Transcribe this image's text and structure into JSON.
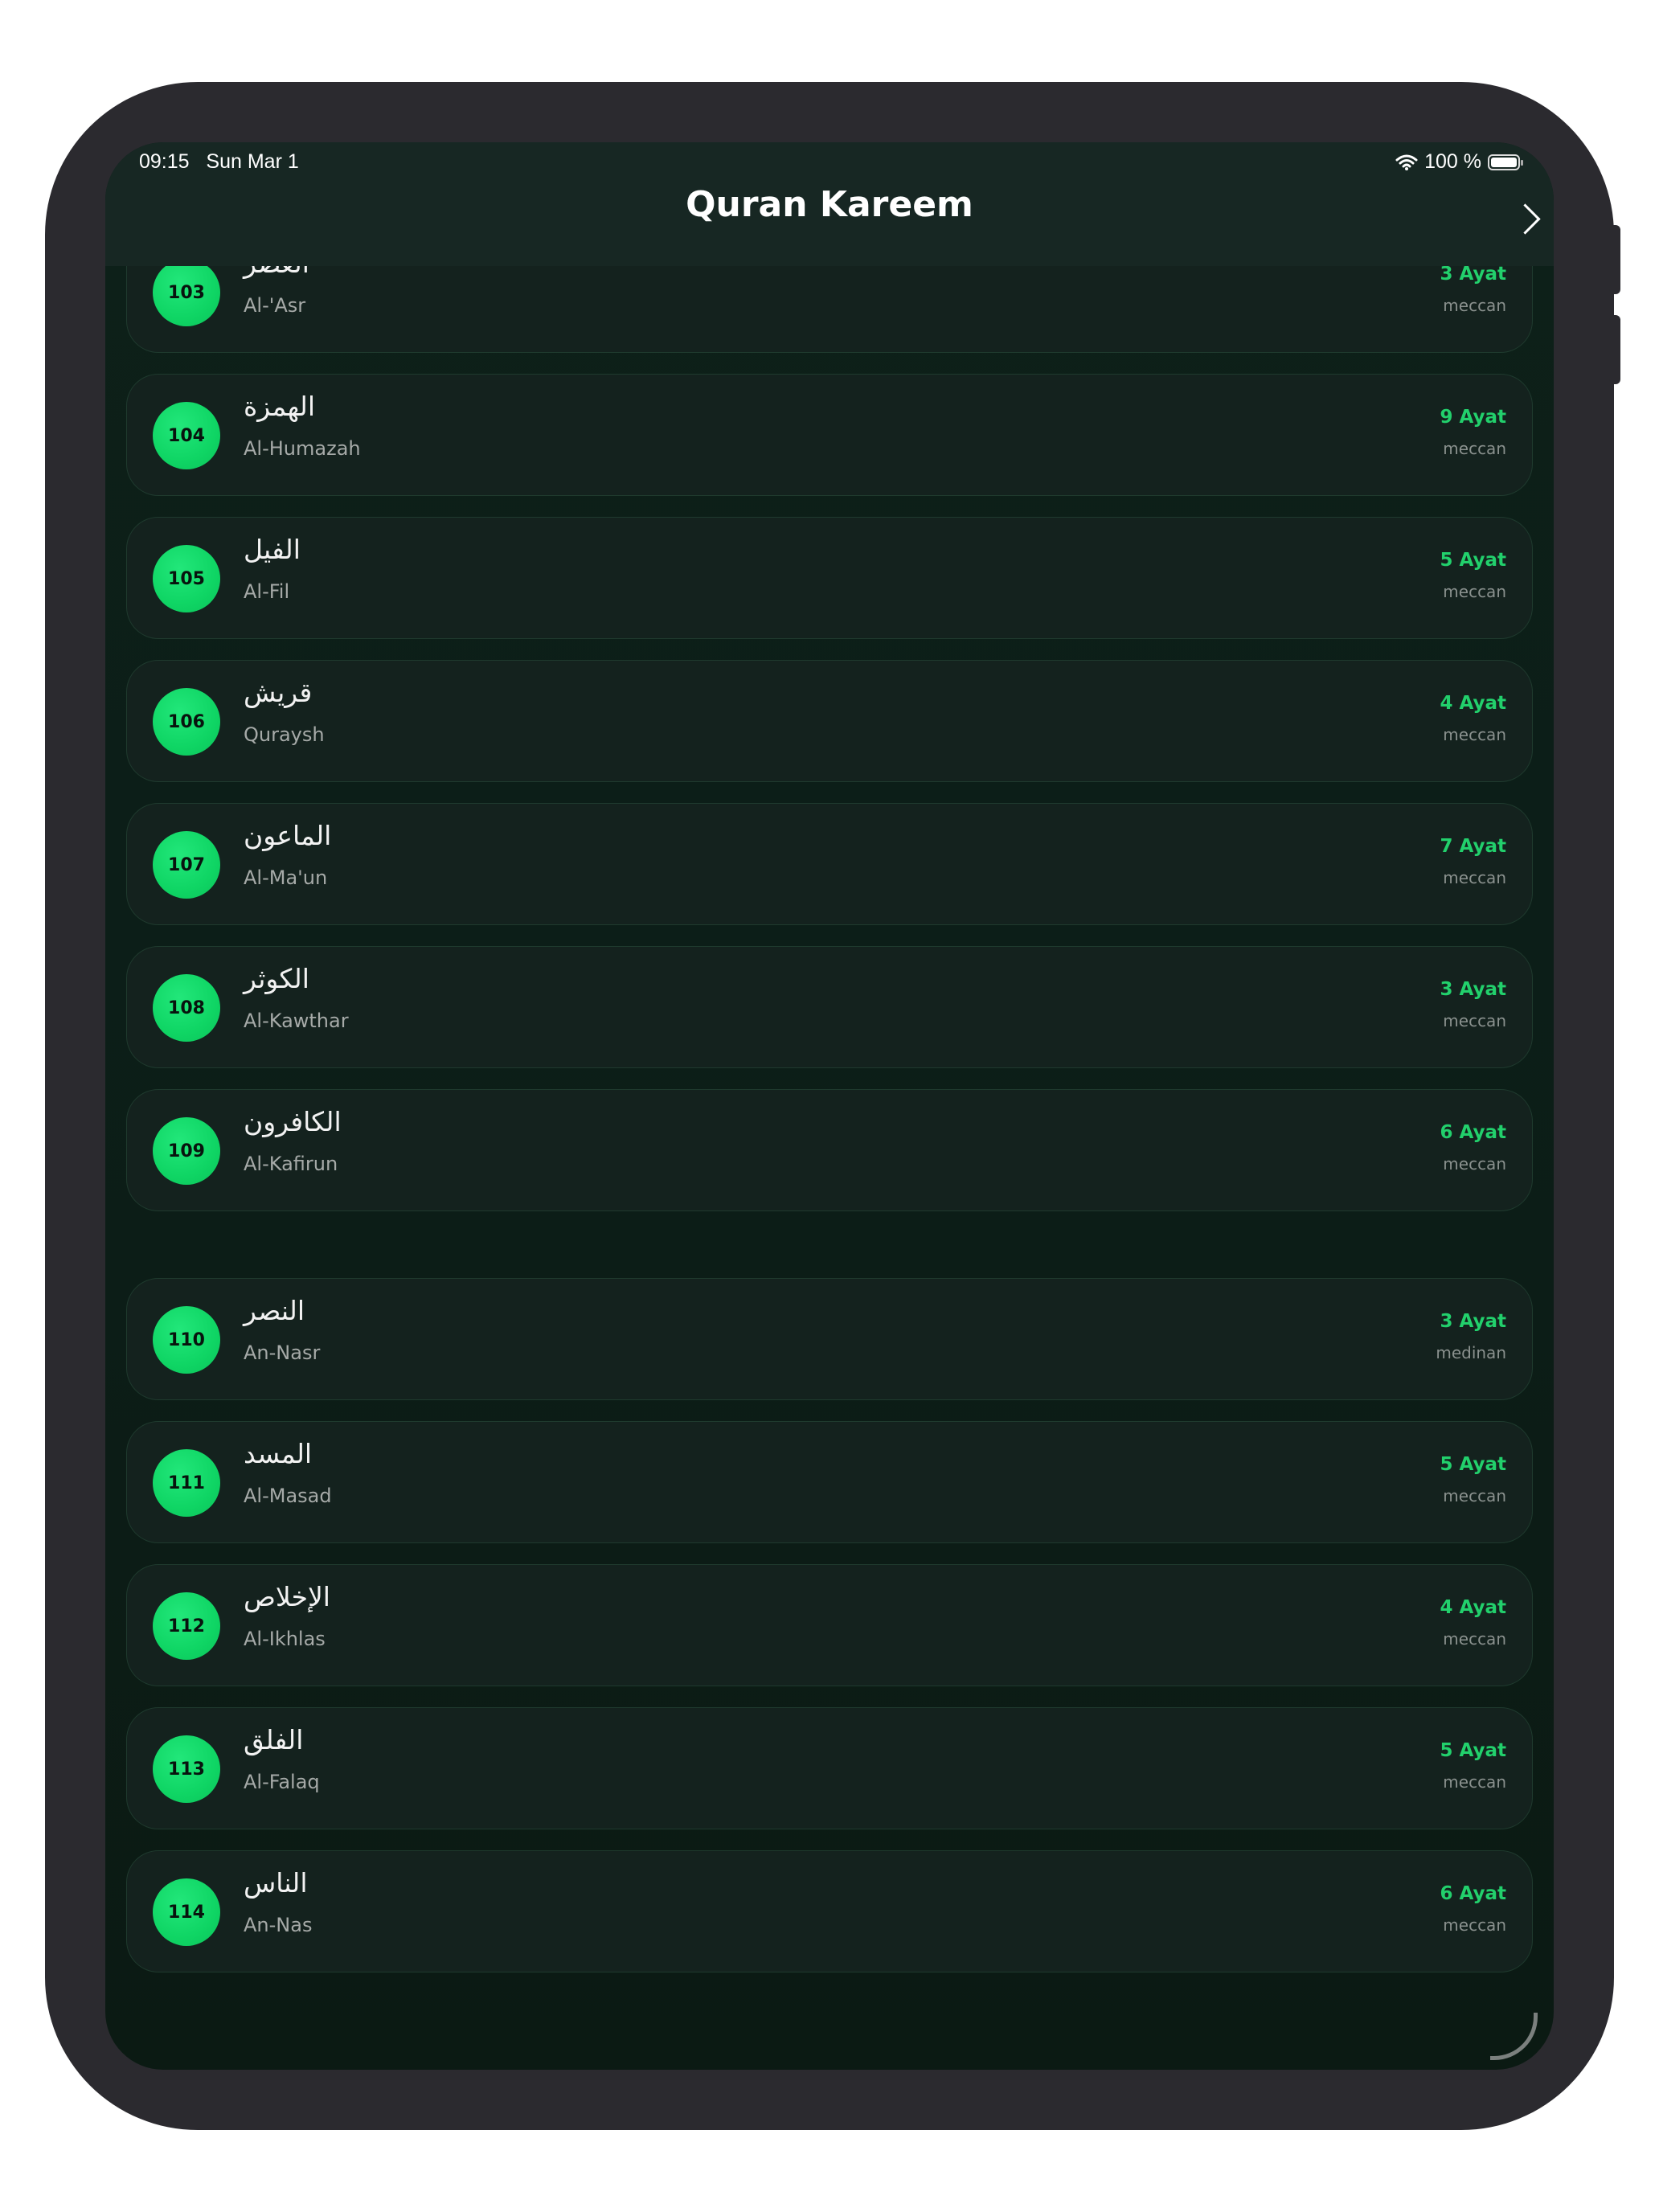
{
  "status_bar": {
    "time": "09:15",
    "date": "Sun Mar 1",
    "battery": "100 %"
  },
  "header": {
    "title": "Quran Kareem"
  },
  "surahs": [
    {
      "number": "103",
      "arabic": "العصر",
      "name": "Al-'Asr",
      "ayat": "3 Ayat",
      "type": "meccan"
    },
    {
      "number": "104",
      "arabic": "الهمزة",
      "name": "Al-Humazah",
      "ayat": "9 Ayat",
      "type": "meccan"
    },
    {
      "number": "105",
      "arabic": "الفيل",
      "name": "Al-Fil",
      "ayat": "5 Ayat",
      "type": "meccan"
    },
    {
      "number": "106",
      "arabic": "قريش",
      "name": "Quraysh",
      "ayat": "4 Ayat",
      "type": "meccan"
    },
    {
      "number": "107",
      "arabic": "الماعون",
      "name": "Al-Ma'un",
      "ayat": "7 Ayat",
      "type": "meccan"
    },
    {
      "number": "108",
      "arabic": "الكوثر",
      "name": "Al-Kawthar",
      "ayat": "3 Ayat",
      "type": "meccan"
    },
    {
      "number": "109",
      "arabic": "الكافرون",
      "name": "Al-Kafirun",
      "ayat": "6 Ayat",
      "type": "meccan"
    },
    {
      "number": "110",
      "arabic": "النصر",
      "name": "An-Nasr",
      "ayat": "3 Ayat",
      "type": "medinan"
    },
    {
      "number": "111",
      "arabic": "المسد",
      "name": "Al-Masad",
      "ayat": "5 Ayat",
      "type": "meccan"
    },
    {
      "number": "112",
      "arabic": "الإخلاص",
      "name": "Al-Ikhlas",
      "ayat": "4 Ayat",
      "type": "meccan"
    },
    {
      "number": "113",
      "arabic": "الفلق",
      "name": "Al-Falaq",
      "ayat": "5 Ayat",
      "type": "meccan"
    },
    {
      "number": "114",
      "arabic": "الناس",
      "name": "An-Nas",
      "ayat": "6 Ayat",
      "type": "meccan"
    }
  ],
  "colors": {
    "accent": "#22d06c",
    "background": "#0c1d17",
    "card": "#14221e"
  }
}
